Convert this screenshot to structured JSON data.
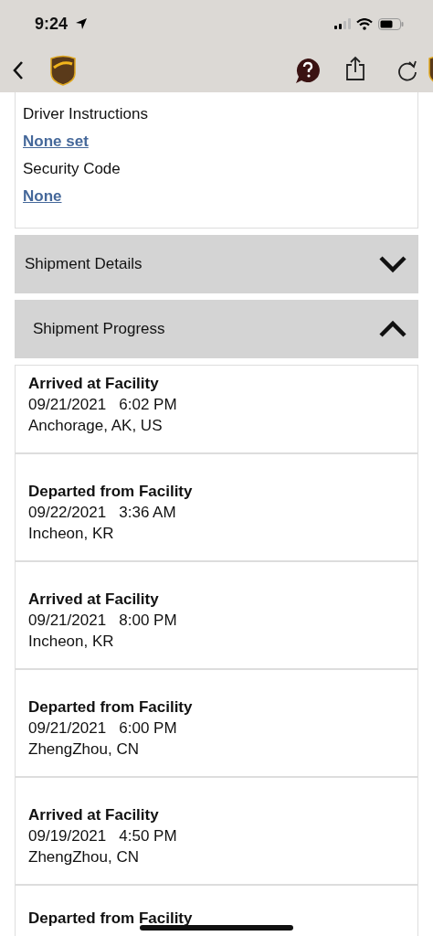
{
  "status_bar": {
    "time": "9:24"
  },
  "details_card": {
    "fields": [
      {
        "label": "Driver Instructions",
        "value": "None set"
      },
      {
        "label": "Security Code",
        "value": "None"
      }
    ]
  },
  "sections": [
    {
      "title": "Shipment Details",
      "expanded": false
    },
    {
      "title": "Shipment Progress",
      "expanded": true
    }
  ],
  "progress": [
    {
      "status": "Arrived at Facility",
      "date": "09/21/2021",
      "time": "6:02 PM",
      "location": "Anchorage, AK, US"
    },
    {
      "status": "Departed from Facility",
      "date": "09/22/2021",
      "time": "3:36 AM",
      "location": "Incheon, KR"
    },
    {
      "status": "Arrived at Facility",
      "date": "09/21/2021",
      "time": "8:00 PM",
      "location": "Incheon, KR"
    },
    {
      "status": "Departed from Facility",
      "date": "09/21/2021",
      "time": "6:00 PM",
      "location": "ZhengZhou, CN"
    },
    {
      "status": "Arrived at Facility",
      "date": "09/19/2021",
      "time": "4:50 PM",
      "location": "ZhengZhou, CN"
    },
    {
      "status": "Departed from Facility"
    }
  ]
}
